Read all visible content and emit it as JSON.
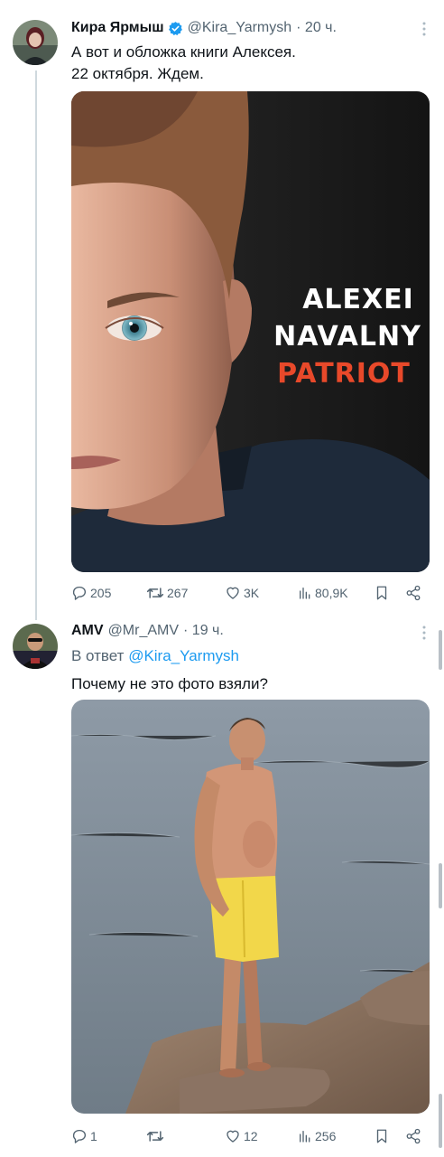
{
  "tweets": [
    {
      "author": "Кира Ярмыш",
      "handle": "@Kira_Yarmysh",
      "time": "· 20 ч.",
      "verified": true,
      "text_lines": [
        "А вот и обложка книги Алексея.",
        "22 октября. Ждем."
      ],
      "cover": {
        "line1": "ALEXEI",
        "line2": "NAVALNY",
        "line3": "PATRIOT"
      },
      "stats": {
        "replies": "205",
        "retweets": "267",
        "likes": "3K",
        "views": "80,9K"
      }
    },
    {
      "author": "AMV",
      "handle": "@Mr_AMV",
      "time": "· 19 ч.",
      "verified": false,
      "reply_prefix": "В ответ",
      "reply_mention": "@Kira_Yarmysh",
      "text_lines": [
        "Почему не это фото взяли?"
      ],
      "stats": {
        "replies": "1",
        "retweets": "",
        "likes": "12",
        "views": "256"
      }
    }
  ],
  "colors": {
    "accent": "#1d9bf0",
    "muted": "#536471",
    "patriot": "#e8492a"
  }
}
